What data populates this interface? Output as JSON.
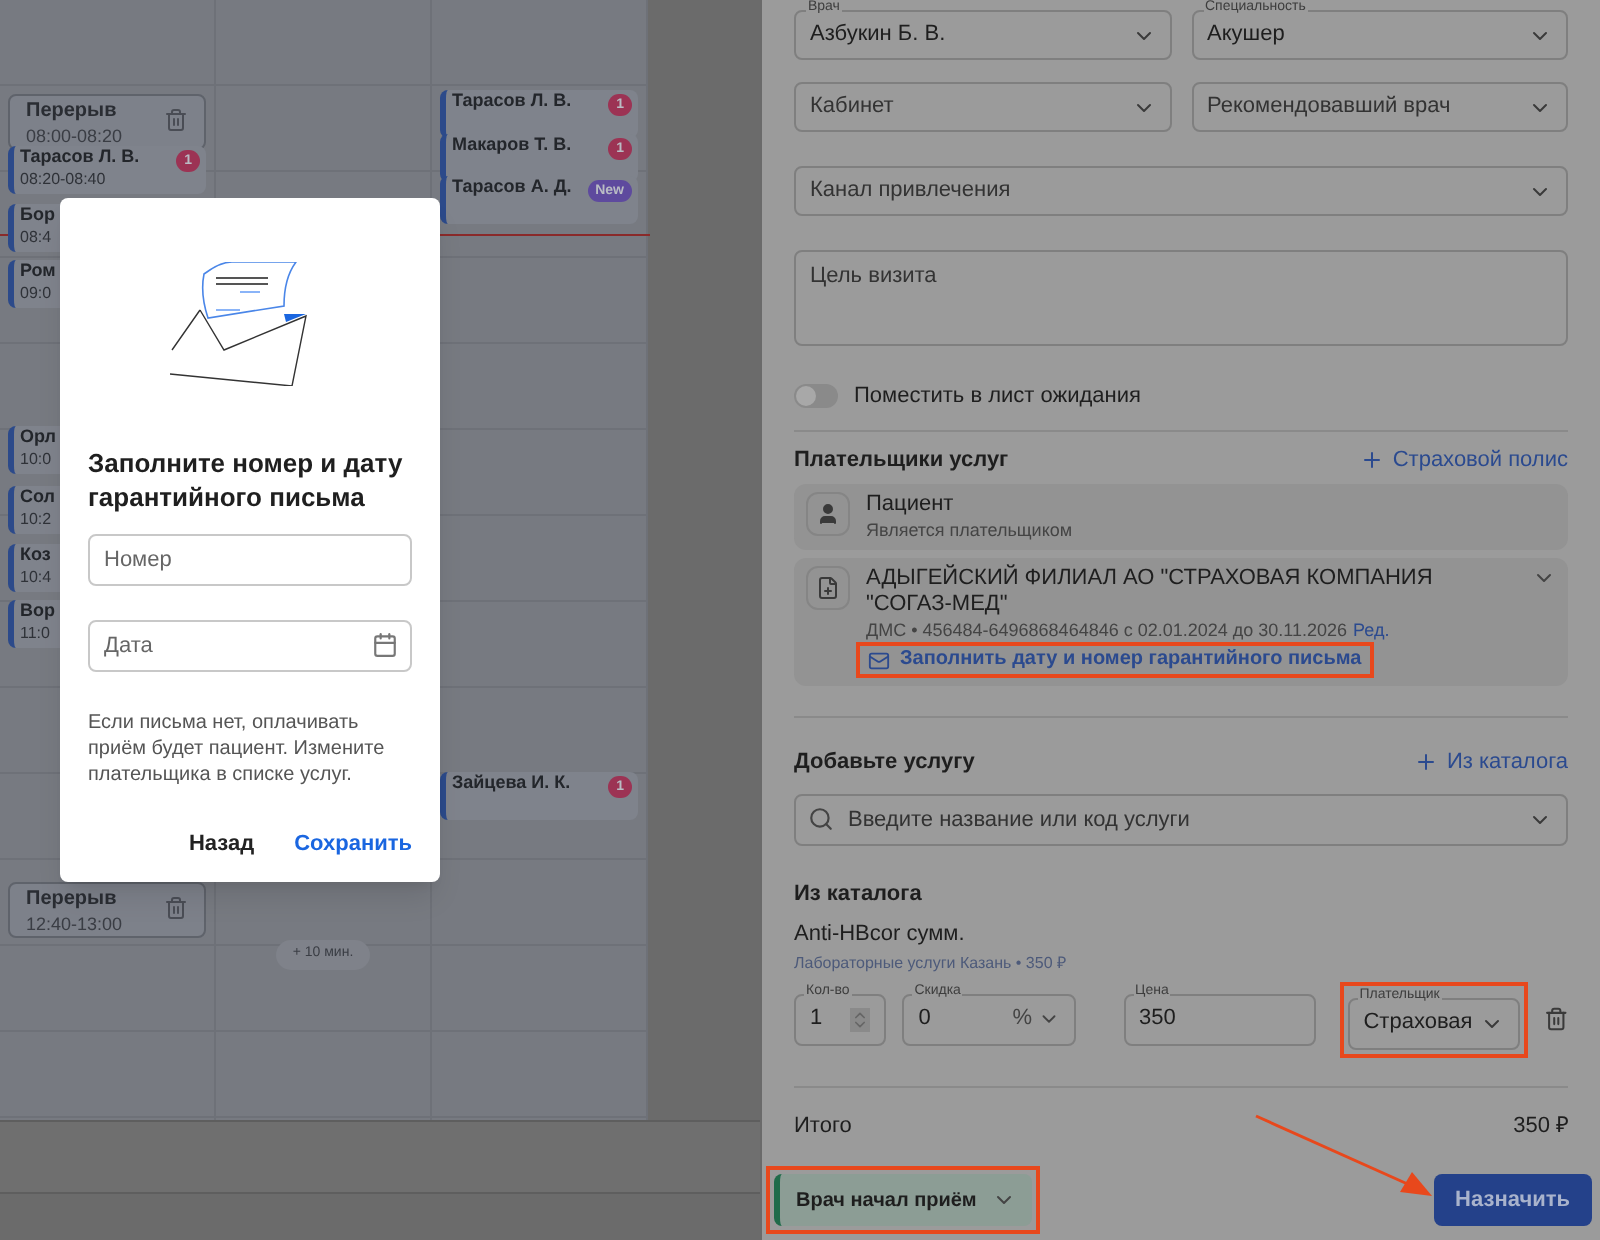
{
  "calendar": {
    "columns": [
      {
        "events": [
          {
            "kind": "break",
            "title": "Перерыв",
            "time": "08:00-08:20"
          },
          {
            "kind": "appointment",
            "name": "Тарасов Л. В.",
            "time": "08:20-08:40",
            "badge": "1",
            "color": "#9c3354"
          },
          {
            "kind": "appointment",
            "name": "Бор",
            "time": "08:4"
          },
          {
            "kind": "appointment",
            "name": "Ром",
            "time": "09:0"
          },
          {
            "kind": "appointment",
            "name": "Орл",
            "time": "10:0"
          },
          {
            "kind": "appointment",
            "name": "Сол",
            "time": "10:2"
          },
          {
            "kind": "appointment",
            "name": "Коз",
            "time": "10:4"
          },
          {
            "kind": "appointment",
            "name": "Вор",
            "time": "11:0"
          },
          {
            "kind": "break",
            "title": "Перерыв",
            "time": "12:40-13:00"
          }
        ]
      },
      {
        "events": [
          {
            "kind": "extend",
            "title": "+ 10 мин."
          }
        ]
      },
      {
        "events": [
          {
            "kind": "appointment",
            "name": "Тарасов Л. В.",
            "badge": "1",
            "color": "#9c3354"
          },
          {
            "kind": "appointment",
            "name": "Макаров Т. В.",
            "badge": "1",
            "color": "#9c3354"
          },
          {
            "kind": "appointment",
            "name": "Тарасов А. Д.",
            "badge": "New",
            "color": "#5e4a9e"
          },
          {
            "kind": "appointment",
            "name": "Зайцева И. К.",
            "badge": "1",
            "color": "#9c3354"
          }
        ]
      }
    ]
  },
  "modal": {
    "title": "Заполните номер и дату гарантийного письма",
    "fields": [
      {
        "kind": "text",
        "placeholder": "Номер"
      },
      {
        "kind": "date",
        "placeholder": "Дата"
      }
    ],
    "note": "Если письма нет, оплачивать приём будет пациент. Измените плательщика в списке услуг.",
    "buttons": [
      {
        "label": "Назад",
        "primary": false
      },
      {
        "label": "Сохранить",
        "primary": true
      }
    ]
  },
  "form": {
    "rows": [
      [
        {
          "label": "Врач",
          "value": "Азбукин Б. В."
        },
        {
          "label": "Специальность",
          "value": "Акушер"
        }
      ],
      [
        {
          "placeholder": "Кабинет"
        },
        {
          "placeholder": "Рекомендовавший врач"
        }
      ],
      [
        {
          "placeholder": "Канал привлечения"
        }
      ]
    ],
    "purpose": {
      "placeholder": "Цель визита"
    },
    "waitlist": {
      "label": "Поместить в лист ожидания",
      "on": false
    }
  },
  "payers": {
    "title": "Плательщики услуг",
    "add": "Страховой полис",
    "items": [
      {
        "kind": "patient",
        "name": "Пациент",
        "sub": "Является плательщиком"
      },
      {
        "kind": "insurance",
        "name": "АДЫГЕЙСКИЙ ФИЛИАЛ АО \"СТРАХОВАЯ КОМПАНИЯ \"СОГАЗ-МЕД\"",
        "sub": "ДМС • 456484-6496868464846 с 02.01.2024 до 30.11.2026",
        "edit": "Ред.",
        "action": "Заполнить дату и номер гарантийного письма"
      }
    ]
  },
  "services": {
    "title": "Добавьте услугу",
    "add": "Из каталога",
    "search": {
      "placeholder": "Введите название или код услуги"
    },
    "group": "Из каталога",
    "items": [
      {
        "name": "Anti-HBcor сумм.",
        "sub": "Лабораторные услуги Казань • 350 ₽",
        "fields": [
          {
            "kind": "stepper",
            "label": "Кол-во",
            "value": "1"
          },
          {
            "kind": "discount",
            "label": "Скидка",
            "value": "0",
            "unit": "%"
          },
          {
            "kind": "text",
            "label": "Цена",
            "value": "350"
          },
          {
            "kind": "select",
            "label": "Плательщик",
            "value": "Страховая"
          }
        ]
      }
    ]
  },
  "total": {
    "label": "Итого",
    "value": "350 ₽"
  },
  "footer": {
    "status": "Врач начал приём",
    "submit": "Назначить"
  }
}
